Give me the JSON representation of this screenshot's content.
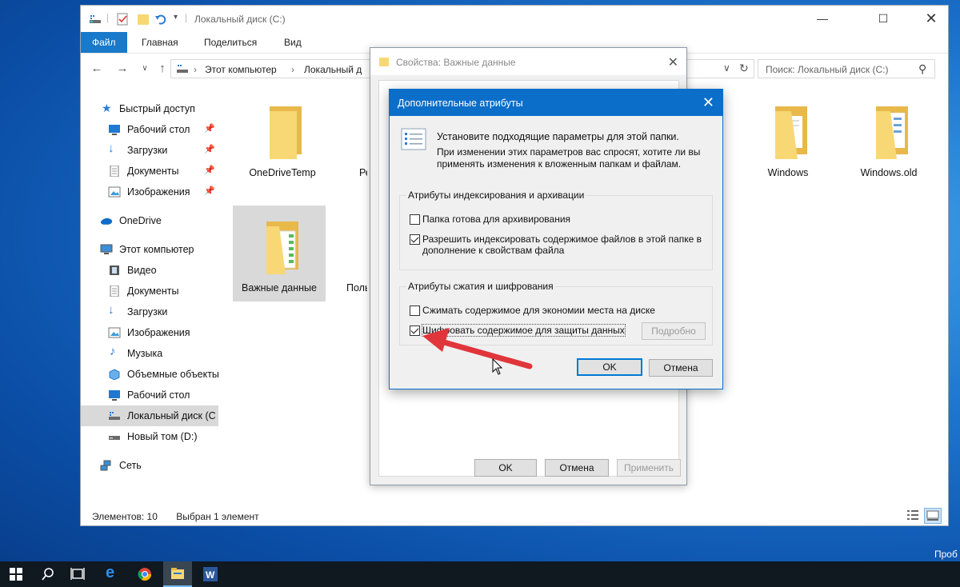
{
  "colors": {
    "accent": "#0b6ec9",
    "file_tab": "#1979ca",
    "folder": "#f8d775",
    "folder_back": "#e8b84a",
    "arrow": "#e0353b"
  },
  "explorer": {
    "title": "Локальный диск (C:)",
    "tabs": {
      "file": "Файл",
      "home": "Главная",
      "share": "Поделиться",
      "view": "Вид"
    },
    "address": {
      "root": "Этот компьютер",
      "current": "Локальный д"
    },
    "search_placeholder": "Поиск: Локальный диск (C:)",
    "sidebar": [
      {
        "label": "Быстрый доступ",
        "icon": "star-icon"
      },
      {
        "label": "Рабочий стол",
        "icon": "desktop-icon",
        "pinned": true
      },
      {
        "label": "Загрузки",
        "icon": "download-icon",
        "pinned": true
      },
      {
        "label": "Документы",
        "icon": "document-icon",
        "pinned": true
      },
      {
        "label": "Изображения",
        "icon": "image-icon",
        "pinned": true
      },
      {
        "label": "OneDrive",
        "icon": "cloud-icon"
      },
      {
        "label": "Этот компьютер",
        "icon": "computer-icon"
      },
      {
        "label": "Видео",
        "icon": "video-icon"
      },
      {
        "label": "Документы",
        "icon": "document-icon"
      },
      {
        "label": "Загрузки",
        "icon": "download-icon"
      },
      {
        "label": "Изображения",
        "icon": "image-icon"
      },
      {
        "label": "Музыка",
        "icon": "music-icon"
      },
      {
        "label": "Объемные объекты",
        "icon": "cube-icon"
      },
      {
        "label": "Рабочий стол",
        "icon": "desktop-icon"
      },
      {
        "label": "Локальный диск (C:)",
        "icon": "drive-icon",
        "selected": true
      },
      {
        "label": "Новый том (D:)",
        "icon": "drive-icon"
      },
      {
        "label": "Сеть",
        "icon": "network-icon"
      }
    ],
    "folders": [
      {
        "name": "OneDriveTemp"
      },
      {
        "name": "Ре"
      },
      {
        "name": "Windows"
      },
      {
        "name": "Windows.old"
      },
      {
        "name": "Важные данные",
        "selected": true
      },
      {
        "name": "Поль"
      }
    ],
    "status": {
      "count": "Элементов: 10",
      "selected": "Выбран 1 элемент"
    }
  },
  "properties": {
    "title": "Свойства: Важные данные",
    "buttons": {
      "ok": "OK",
      "cancel": "Отмена",
      "apply": "Применить"
    }
  },
  "advanced": {
    "title": "Дополнительные атрибуты",
    "intro_line1": "Установите подходящие параметры для этой папки.",
    "intro_line2": "При изменении этих параметров вас спросят, хотите ли вы",
    "intro_line3": "применять изменения к вложенным папкам и файлам.",
    "group1": {
      "label": "Атрибуты индексирования и архивации",
      "archive": {
        "label": "Папка готова для архивирования",
        "checked": false
      },
      "index": {
        "label_line1": "Разрешить индексировать содержимое файлов в этой папке в",
        "label_line2": "дополнение к свойствам файла",
        "checked": true
      }
    },
    "group2": {
      "label": "Атрибуты сжатия и шифрования",
      "compress": {
        "label": "Сжимать содержимое для экономии места на диске",
        "checked": false
      },
      "encrypt": {
        "label": "Шифровать содержимое для защиты данных",
        "checked": true
      },
      "details_button": "Подробно"
    },
    "buttons": {
      "ok": "OK",
      "cancel": "Отмена"
    }
  },
  "desktop": {
    "corner_text": "Проб"
  }
}
